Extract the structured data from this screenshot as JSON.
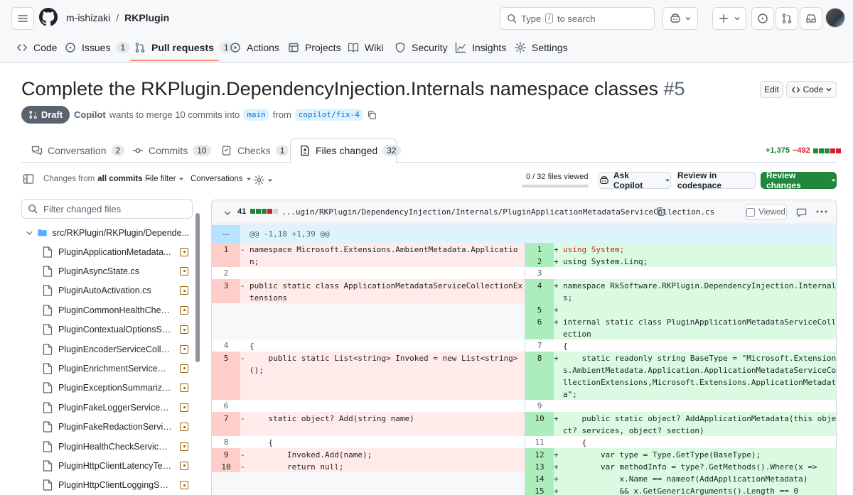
{
  "header": {
    "owner": "m-ishizaki",
    "separator": "/",
    "repo": "RKPlugin",
    "search_placeholder": "Type / to search",
    "search_before": "Type",
    "search_key": "/",
    "search_after": "to search"
  },
  "repo_nav": [
    {
      "label": "Code",
      "count": ""
    },
    {
      "label": "Issues",
      "count": "1"
    },
    {
      "label": "Pull requests",
      "count": "1"
    },
    {
      "label": "Actions",
      "count": ""
    },
    {
      "label": "Projects",
      "count": ""
    },
    {
      "label": "Wiki",
      "count": ""
    },
    {
      "label": "Security",
      "count": ""
    },
    {
      "label": "Insights",
      "count": ""
    },
    {
      "label": "Settings",
      "count": ""
    }
  ],
  "pr": {
    "title": "Complete the RKPlugin.DependencyInjection.Internals namespace classes",
    "number": "#5",
    "status": "Draft",
    "author": "Copilot",
    "merge_text": "wants to merge 10 commits into",
    "base_branch": "main",
    "from_text": "from",
    "head_branch": "copilot/fix-4",
    "edit_label": "Edit",
    "code_label": "Code"
  },
  "pr_tabs": [
    {
      "label": "Conversation",
      "count": "2"
    },
    {
      "label": "Commits",
      "count": "10"
    },
    {
      "label": "Checks",
      "count": "1"
    },
    {
      "label": "Files changed",
      "count": "32"
    }
  ],
  "diffstat": {
    "additions": "+1,375",
    "deletions": "−492"
  },
  "toolbar": {
    "changes_from_prefix": "Changes from",
    "changes_from_value": "all commits",
    "file_filter": "File filter",
    "conversations": "Conversations",
    "files_viewed": "0 / 32 files viewed",
    "files_viewed_fraction": 0,
    "ask_copilot": "Ask Copilot",
    "review_codespace": "Review in codespace",
    "review_changes": "Review changes"
  },
  "tree": {
    "filter_placeholder": "Filter changed files",
    "folder": "src/RKPlugin/RKPlugin/Depende...",
    "files": [
      "PluginApplicationMetadata...",
      "PluginAsyncState.cs",
      "PluginAutoActivation.cs",
      "PluginCommonHealthCheck...",
      "PluginContextualOptionsSer...",
      "PluginEncoderServiceCollect...",
      "PluginEnrichmentServiceCol...",
      "PluginExceptionSummarizat...",
      "PluginFakeLoggerServiceCol...",
      "PluginFakeRedactionService...",
      "PluginHealthCheckServiceC...",
      "PluginHttpClientLatencyTele...",
      "PluginHttpClientLoggingSer..."
    ]
  },
  "diff": {
    "count": "41",
    "path": "...ugin/RKPlugin/DependencyInjection/Internals/PluginApplicationMetadataServiceCollection.cs",
    "viewed_label": "Viewed",
    "expand_label": "...",
    "hunk": "@@ -1,18 +1,39 @@",
    "lines": {
      "l1": "namespace Microsoft.Extensions.AmbientMetadata.Application;",
      "r1": "using System;",
      "r2": "using System.Linq;",
      "l3": "public static class ApplicationMetadataServiceCollectionExtensions",
      "r4": "namespace RkSoftware.RKPlugin.DependencyInjection.Internals;",
      "r6": "internal static class PluginApplicationMetadataServiceCollection",
      "l4": "{",
      "r7": "{",
      "l5": "    public static List<string> Invoked = new List<string>();",
      "r8": "    static readonly string BaseType = \"Microsoft.Extensions.AmbientMetadata.Application.ApplicationMetadataServiceCollectionExtensions,Microsoft.Extensions.ApplicationMetadata\";",
      "l7": "    static object? Add(string name)",
      "r10": "    public static object? AddApplicationMetadata(this object? services, object? section)",
      "l8": "    {",
      "r11": "    {",
      "l9": "        Invoked.Add(name);",
      "r12": "        var type = Type.GetType(BaseType);",
      "l10": "        return null;",
      "r13": "        var methodInfo = type?.GetMethods().Where(x =>",
      "r14": "            x.Name == nameof(AddApplicationMetadata)",
      "r15": "            && x.GetGenericArguments().Length == 0"
    },
    "numbers": {
      "l": [
        "1",
        "2",
        "3",
        "4",
        "5",
        "6",
        "7",
        "8",
        "9",
        "10"
      ],
      "r": [
        "1",
        "2",
        "3",
        "4",
        "5",
        "6",
        "7",
        "8",
        "9",
        "10",
        "11",
        "12",
        "13",
        "14",
        "15"
      ]
    }
  },
  "colors": {
    "accent": "#fd8c73",
    "green": "#1f883d",
    "red": "#cf222e"
  }
}
